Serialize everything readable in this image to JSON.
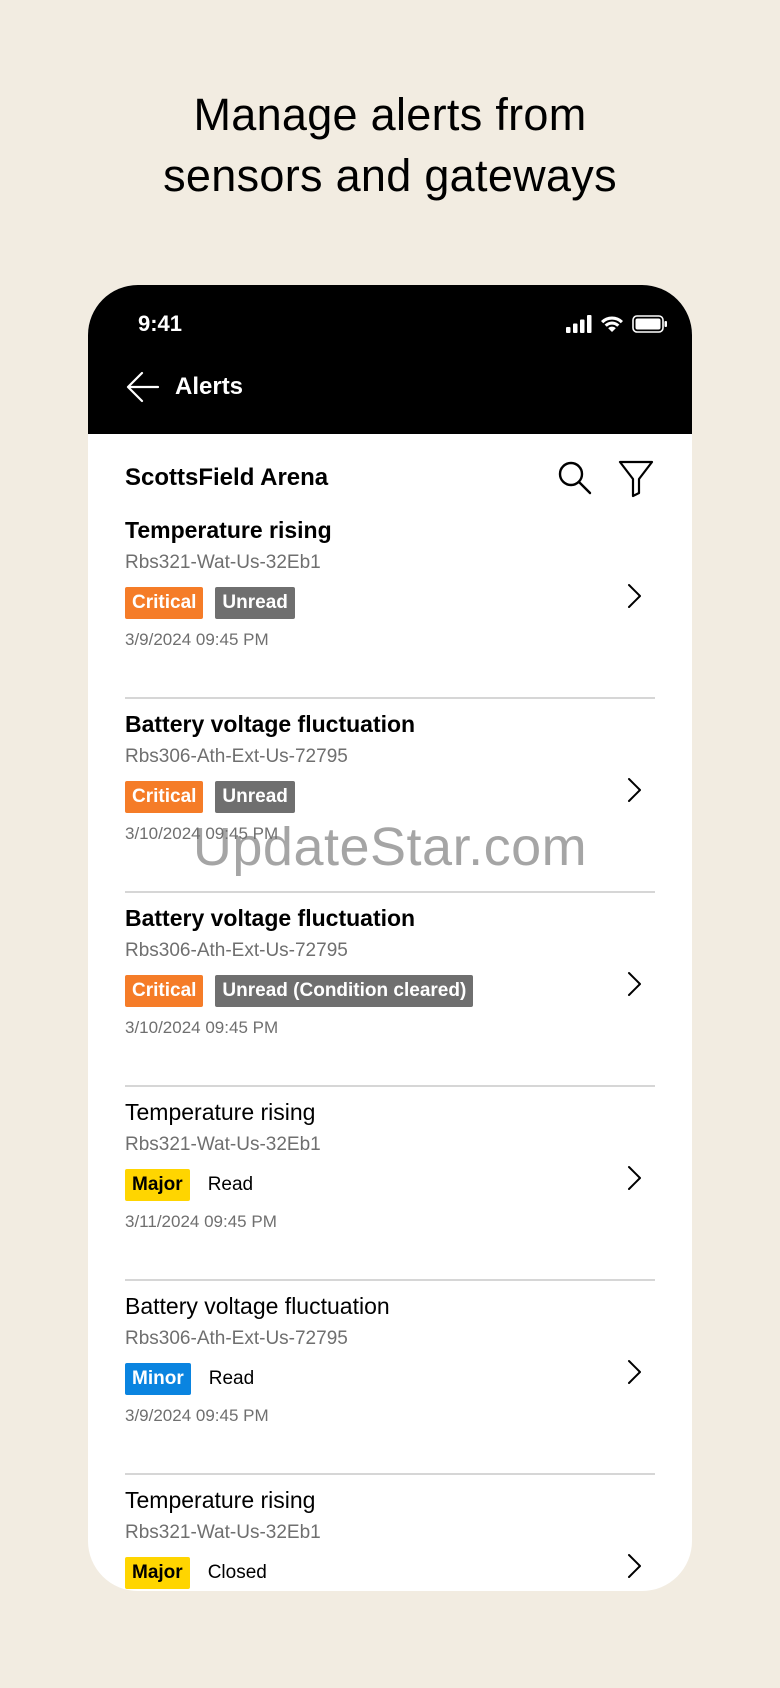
{
  "headline": {
    "line1": "Manage alerts from",
    "line2": "sensors and gateways"
  },
  "status_bar": {
    "time": "9:41",
    "icons": [
      "signal-icon",
      "wifi-icon",
      "battery-icon"
    ]
  },
  "nav": {
    "title": "Alerts",
    "back_icon": "arrow-left-icon"
  },
  "site": {
    "title": "ScottsField Arena",
    "search_icon": "search-icon",
    "filter_icon": "filter-icon"
  },
  "alerts": [
    {
      "title": "Temperature rising",
      "device": "Rbs321-Wat-Us-32Eb1",
      "severity": "Critical",
      "status": "Unread",
      "date": "3/9/2024 09:45 PM"
    },
    {
      "title": "Battery voltage fluctuation",
      "device": "Rbs306-Ath-Ext-Us-72795",
      "severity": "Critical",
      "status": "Unread",
      "date": "3/10/2024 09:45 PM"
    },
    {
      "title": "Battery voltage fluctuation",
      "device": "Rbs306-Ath-Ext-Us-72795",
      "severity": "Critical",
      "status": "Unread (Condition cleared)",
      "date": "3/10/2024 09:45 PM"
    },
    {
      "title": "Temperature rising",
      "device": "Rbs321-Wat-Us-32Eb1",
      "severity": "Major",
      "status": "Read",
      "date": "3/11/2024 09:45 PM"
    },
    {
      "title": "Battery voltage fluctuation",
      "device": "Rbs306-Ath-Ext-Us-72795",
      "severity": "Minor",
      "status": "Read",
      "date": "3/9/2024 09:45 PM"
    },
    {
      "title": "Temperature rising",
      "device": "Rbs321-Wat-Us-32Eb1",
      "severity": "Major",
      "status": "Closed",
      "date": ""
    }
  ],
  "colors": {
    "background": "#F2ECE1",
    "header": "#000000",
    "critical": "#F57C28",
    "major": "#FFD500",
    "minor": "#0A84E0",
    "unread": "#6F6F6F",
    "divider": "#D6D6D6"
  },
  "watermark": "UpdateStar.com"
}
